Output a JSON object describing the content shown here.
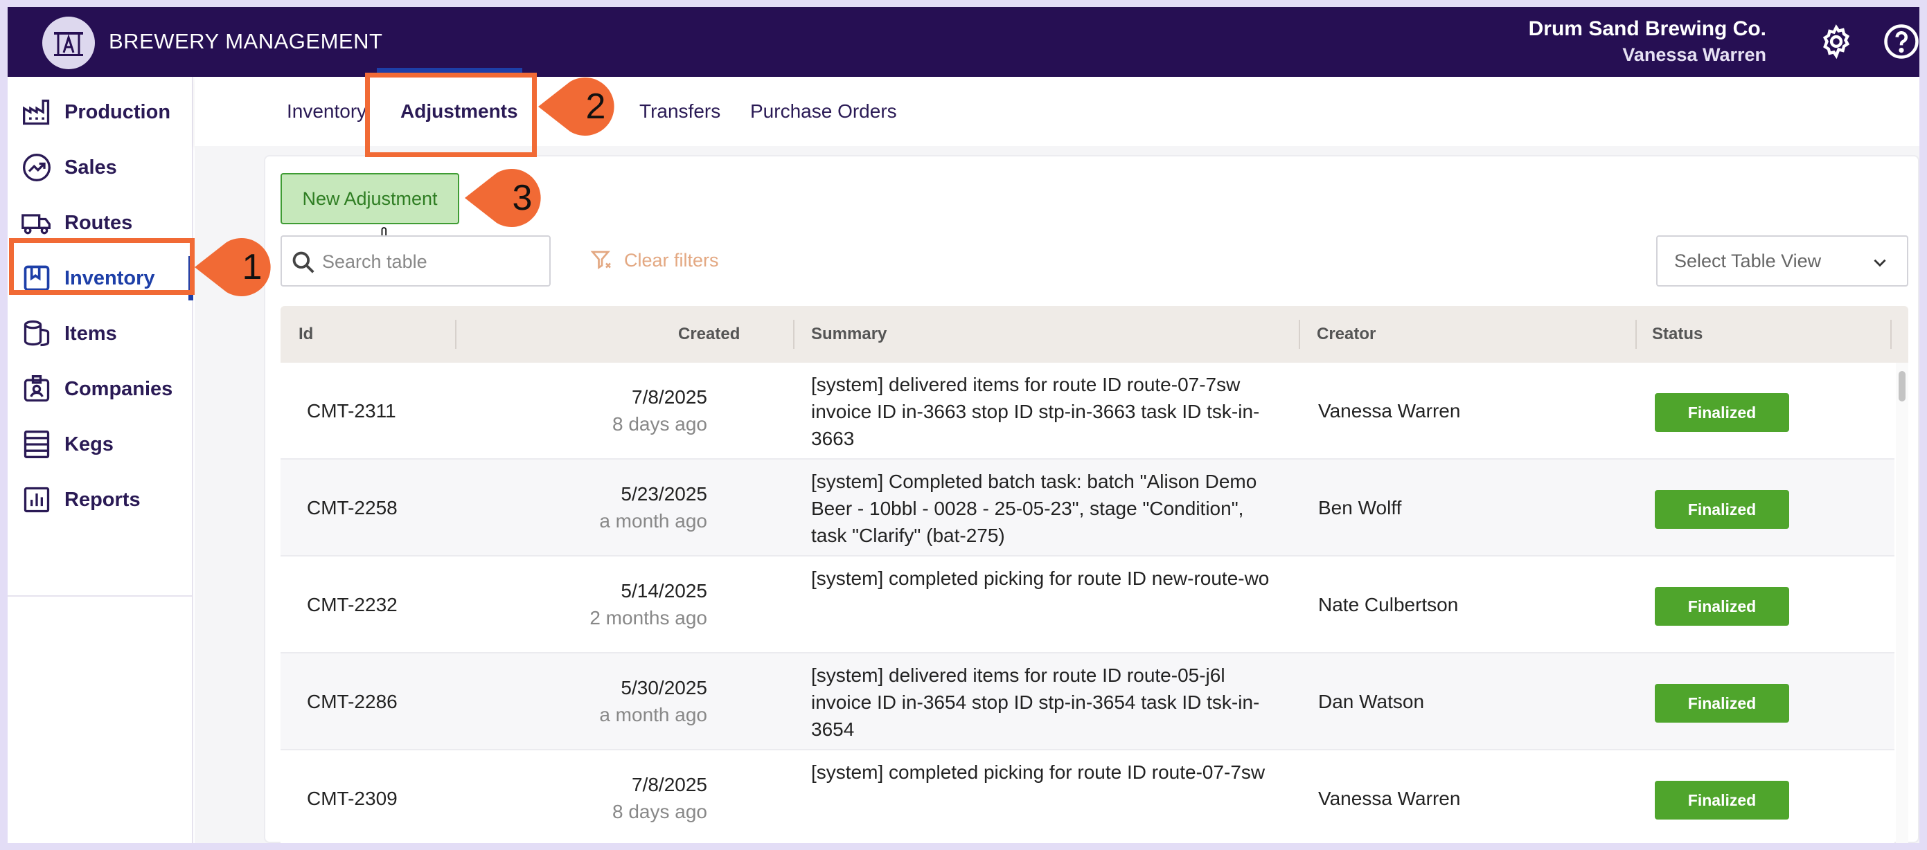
{
  "header": {
    "title": "BREWERY MANAGEMENT",
    "company": "Drum Sand Brewing Co.",
    "user": "Vanessa Warren",
    "icons": [
      "logo-icon",
      "gear-icon",
      "help-icon"
    ]
  },
  "sidebar": {
    "items": [
      {
        "label": "Production",
        "icon": "factory-icon"
      },
      {
        "label": "Sales",
        "icon": "trend-icon"
      },
      {
        "label": "Routes",
        "icon": "truck-icon"
      },
      {
        "label": "Inventory",
        "icon": "bookmark-icon",
        "active": true
      },
      {
        "label": "Items",
        "icon": "barrels-icon"
      },
      {
        "label": "Companies",
        "icon": "badge-icon"
      },
      {
        "label": "Kegs",
        "icon": "kegs-icon"
      },
      {
        "label": "Reports",
        "icon": "report-icon"
      }
    ]
  },
  "tabs": [
    {
      "label": "Inventory"
    },
    {
      "label": "Adjustments",
      "active": true
    },
    {
      "label": "Transfers"
    },
    {
      "label": "Purchase Orders"
    }
  ],
  "toolbar": {
    "new_label": "New Adjustment",
    "search_placeholder": "Search table",
    "clear_label": "Clear filters",
    "view_placeholder": "Select Table View"
  },
  "table": {
    "columns": [
      "Id",
      "Created",
      "Summary",
      "Creator",
      "Status"
    ],
    "rows": [
      {
        "id": "CMT-2311",
        "date": "7/8/2025",
        "ago": "8 days ago",
        "summary": "[system] delivered items for route ID route-07-7sw invoice ID in-3663 stop ID stp-in-3663 task ID tsk-in-3663",
        "creator": "Vanessa Warren",
        "status": "Finalized"
      },
      {
        "id": "CMT-2258",
        "date": "5/23/2025",
        "ago": "a month ago",
        "summary": "[system] Completed batch task: batch \"Alison Demo Beer - 10bbl - 0028 - 25-05-23\", stage \"Condition\", task \"Clarify\" (bat-275)",
        "creator": "Ben Wolff",
        "status": "Finalized"
      },
      {
        "id": "CMT-2232",
        "date": "5/14/2025",
        "ago": "2 months ago",
        "summary": "[system] completed picking for route ID new-route-wo",
        "creator": "Nate Culbertson",
        "status": "Finalized"
      },
      {
        "id": "CMT-2286",
        "date": "5/30/2025",
        "ago": "a month ago",
        "summary": "[system] delivered items for route ID route-05-j6l invoice ID in-3654 stop ID stp-in-3654 task ID tsk-in-3654",
        "creator": "Dan Watson",
        "status": "Finalized"
      },
      {
        "id": "CMT-2309",
        "date": "7/8/2025",
        "ago": "8 days ago",
        "summary": "[system] completed picking for route ID route-07-7sw",
        "creator": "Vanessa Warren",
        "status": "Finalized"
      }
    ]
  },
  "annotations": {
    "callouts": [
      "1",
      "2",
      "3"
    ],
    "color": "#f16a35"
  },
  "colors": {
    "header_bg": "#260f53",
    "accent": "#1d3fa8",
    "status_finalized": "#4fa52c",
    "new_button_bg": "#c6e8bb"
  }
}
